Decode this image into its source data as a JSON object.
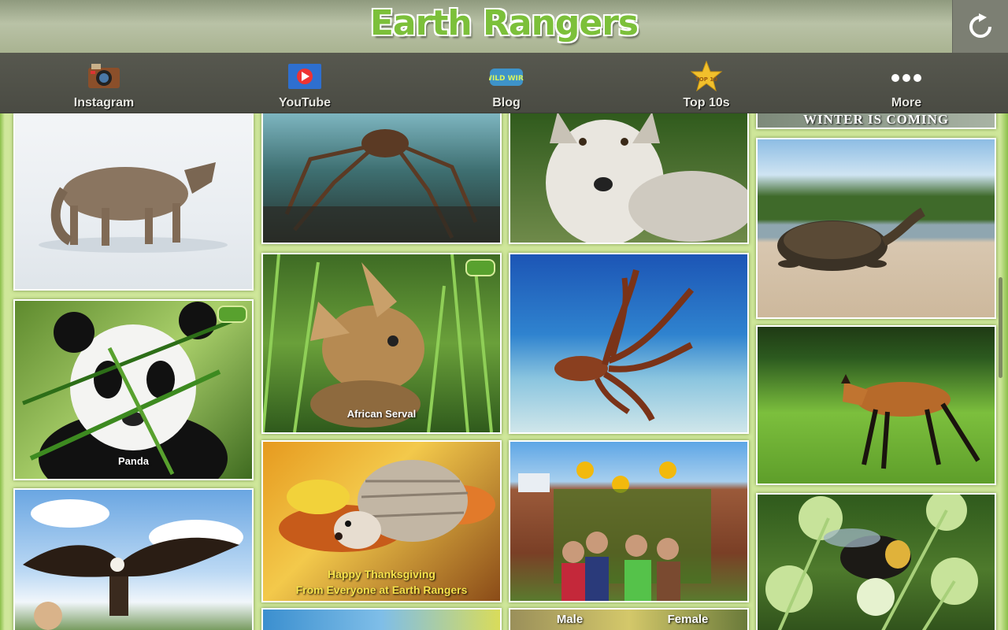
{
  "app": {
    "title": "Earth Rangers"
  },
  "nav": {
    "items": [
      {
        "label": "Instagram",
        "icon": "camera-icon"
      },
      {
        "label": "YouTube",
        "icon": "play-icon"
      },
      {
        "label": "Blog",
        "icon": "wild-wire-icon"
      },
      {
        "label": "Top 10s",
        "icon": "star-icon"
      },
      {
        "label": "More",
        "icon": "more-dots-icon"
      }
    ],
    "top10_badge": "TOP 10",
    "wild_badge": "WILD WIRE"
  },
  "refresh_icon": "refresh-icon",
  "tiles": {
    "wolf_snow": "",
    "spider_crab": "",
    "grey_wolf": "",
    "winter_banner": "WINTER IS COMING",
    "serval": "African Serval",
    "octopus": "",
    "turtle": "",
    "panda": "Panda",
    "maned_wolf": "",
    "hedgehog_line1": "Happy Thanksgiving",
    "hedgehog_line2": "From Everyone at Earth Rangers",
    "sunflowers": "",
    "bee": "",
    "eagle": "",
    "male_label": "Male",
    "female_label": "Female"
  },
  "colors": {
    "background": "#cfe79a",
    "nav_bg": "#4f5048",
    "logo_green": "#7cc03a",
    "header_bg": "#a9b391"
  }
}
